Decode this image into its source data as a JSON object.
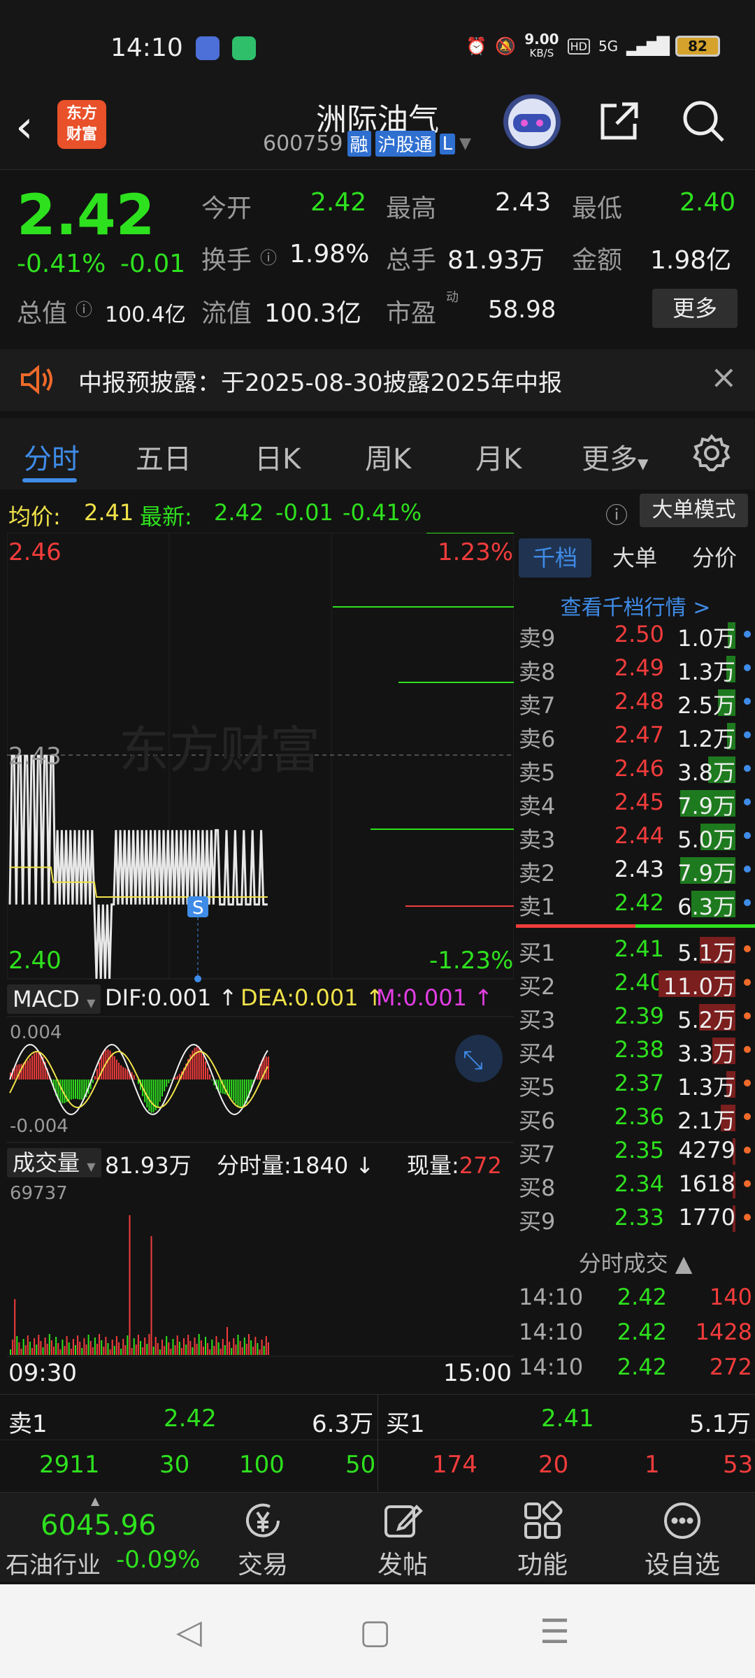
{
  "status": {
    "time": "14:10",
    "speed_value": "9.00",
    "speed_unit": "KB/S",
    "network": "5G",
    "hd": "HD",
    "battery": "82"
  },
  "header": {
    "logo_line1": "东方",
    "logo_line2": "财富",
    "name": "洲际油气",
    "code": "600759",
    "tags": [
      "融",
      "沪股通",
      "L"
    ]
  },
  "quote": {
    "price": "2.42",
    "change_pct": "-0.41%",
    "change": "-0.01",
    "open_label": "今开",
    "open": "2.42",
    "high_label": "最高",
    "high": "2.43",
    "low_label": "最低",
    "low": "2.40",
    "turnover_label": "换手",
    "turnover": "1.98%",
    "volume_label": "总手",
    "volume": "81.93万",
    "amount_label": "金额",
    "amount": "1.98亿",
    "mktcap_label": "总值",
    "mktcap": "100.4亿",
    "float_label": "流值",
    "float": "100.3亿",
    "pe_label": "市盈",
    "pe_super": "动",
    "pe": "58.98",
    "more_btn": "更多"
  },
  "notice": {
    "text": "中报预披露：于2025-08-30披露2025年中报"
  },
  "tabs": [
    "分时",
    "五日",
    "日K",
    "周K",
    "月K",
    "更多"
  ],
  "avg": {
    "avg_label": "均价:",
    "avg_value": "2.41",
    "latest_label": "最新:",
    "latest_value": "2.42",
    "change": "-0.01",
    "pct": "-0.41%",
    "big_order_btn": "大单模式"
  },
  "chart_data": {
    "type": "line",
    "price_top": "2.46",
    "price_mid": "2.43",
    "price_bottom": "2.40",
    "pct_top": "1.23%",
    "pct_bottom": "-1.23%",
    "watermark": "东方财富",
    "marker": "S",
    "macd_label": "MACD",
    "dif": "DIF:0.001",
    "dea": "DEA:0.001",
    "m": "M:0.001",
    "macd_top": "0.004",
    "macd_bottom": "-0.004",
    "vol_label": "成交量",
    "vol_total": "81.93万",
    "vol_tick_label": "分时量:1840",
    "vol_now_label": "现量:",
    "vol_now": "272",
    "vol_max": "69737",
    "time_start": "09:30",
    "time_end": "15:00"
  },
  "book": {
    "tabs": [
      "千档",
      "大单",
      "分价"
    ],
    "view_link": "查看千档行情 >",
    "asks": [
      {
        "label": "卖9",
        "price": "2.50",
        "vol": "1.0万",
        "share": 0.1
      },
      {
        "label": "卖8",
        "price": "2.49",
        "vol": "1.3万",
        "share": 0.12
      },
      {
        "label": "卖7",
        "price": "2.48",
        "vol": "2.5万",
        "share": 0.23
      },
      {
        "label": "卖6",
        "price": "2.47",
        "vol": "1.2万",
        "share": 0.11
      },
      {
        "label": "卖5",
        "price": "2.46",
        "vol": "3.8万",
        "share": 0.35
      },
      {
        "label": "卖4",
        "price": "2.45",
        "vol": "7.9万",
        "share": 0.72
      },
      {
        "label": "卖3",
        "price": "2.44",
        "vol": "5.0万",
        "share": 0.45
      },
      {
        "label": "卖2",
        "price": "2.43",
        "vol": "7.9万",
        "share": 0.72
      },
      {
        "label": "卖1",
        "price": "2.42",
        "vol": "6.3万",
        "share": 0.57
      }
    ],
    "bids": [
      {
        "label": "买1",
        "price": "2.41",
        "vol": "5.1万",
        "share": 0.46
      },
      {
        "label": "买2",
        "price": "2.40",
        "vol": "11.0万",
        "share": 1.0
      },
      {
        "label": "买3",
        "price": "2.39",
        "vol": "5.2万",
        "share": 0.47
      },
      {
        "label": "买4",
        "price": "2.38",
        "vol": "3.3万",
        "share": 0.3
      },
      {
        "label": "买5",
        "price": "2.37",
        "vol": "1.3万",
        "share": 0.12
      },
      {
        "label": "买6",
        "price": "2.36",
        "vol": "2.1万",
        "share": 0.19
      },
      {
        "label": "买7",
        "price": "2.35",
        "vol": "4279",
        "share": 0.04
      },
      {
        "label": "买8",
        "price": "2.34",
        "vol": "1618",
        "share": 0.015
      },
      {
        "label": "买9",
        "price": "2.33",
        "vol": "1770",
        "share": 0.016
      }
    ],
    "trades_title": "分时成交",
    "trades": [
      {
        "time": "14:10",
        "price": "2.42",
        "vol": "140"
      },
      {
        "time": "14:10",
        "price": "2.42",
        "vol": "1428"
      },
      {
        "time": "14:10",
        "price": "2.42",
        "vol": "272"
      }
    ]
  },
  "summary": {
    "ask_label": "卖1",
    "ask_price": "2.42",
    "ask_vol": "6.3万",
    "bid_label": "买1",
    "bid_price": "2.41",
    "bid_vol": "5.1万",
    "ask_queue": [
      "2911",
      "30",
      "100",
      "50"
    ],
    "bid_queue": [
      "174",
      "20",
      "1",
      "53"
    ]
  },
  "bottomnav": {
    "index_value": "6045.96",
    "index_name": "石油行业",
    "index_change": "-0.09%",
    "items": [
      "交易",
      "发帖",
      "功能",
      "设自选"
    ]
  },
  "colors": {
    "up": "#f23c3c",
    "down": "#2ee11e",
    "accent": "#3f8ce8",
    "avg_line": "#f0e24a"
  }
}
